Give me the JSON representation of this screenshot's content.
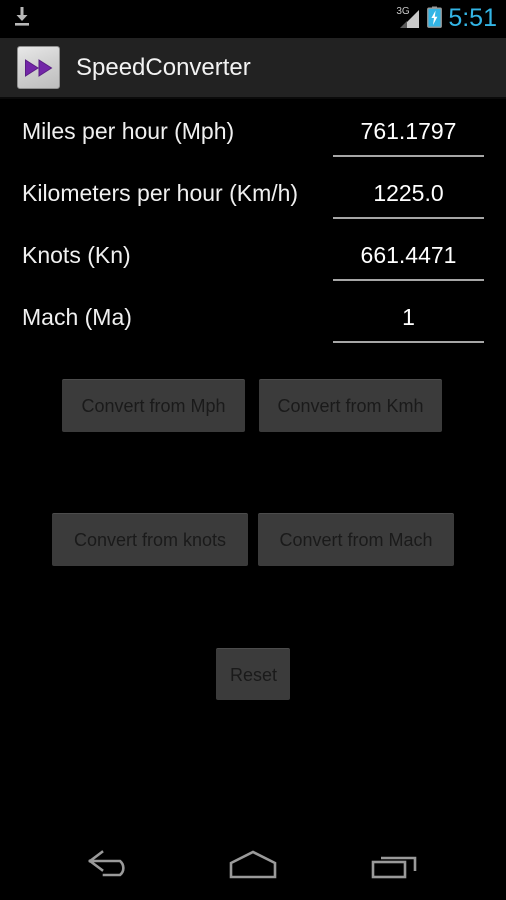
{
  "status_bar": {
    "download_icon": "download-icon",
    "network_label": "3G",
    "signal_icon": "signal-bars-icon",
    "battery_icon": "battery-charging-icon",
    "clock": "5:51",
    "clock_color": "#33b5e5",
    "battery_color": "#33b5e5"
  },
  "action_bar": {
    "app_icon": "fast-forward-icon",
    "app_icon_color": "#7326a8",
    "title": "SpeedConverter",
    "background": "#222222"
  },
  "form": {
    "fields": [
      {
        "label": "Miles per hour (Mph)",
        "value": "761.1797",
        "unit": "Mph",
        "name": "mph"
      },
      {
        "label": "Kilometers per hour (Km/h)",
        "value": "1225.0",
        "unit": "Km/h",
        "name": "kmh"
      },
      {
        "label": "Knots (Kn)",
        "value": "661.4471",
        "unit": "Kn",
        "name": "knots"
      },
      {
        "label": "Mach (Ma)",
        "value": "1",
        "unit": "Ma",
        "name": "mach"
      }
    ],
    "underline_color": "#a6a6a6"
  },
  "buttons": {
    "convert_from_mph": "Convert from Mph",
    "convert_from_kmh": "Convert from Kmh",
    "convert_from_knots": "Convert from knots",
    "convert_from_mach": "Convert from Mach",
    "reset": "Reset",
    "face_color": "#3b3b3b",
    "text_color": "#1a1a1a"
  },
  "nav_bar": {
    "back": "back-icon",
    "home": "home-icon",
    "recents": "recents-icon",
    "icon_color": "#9a9a9a"
  }
}
